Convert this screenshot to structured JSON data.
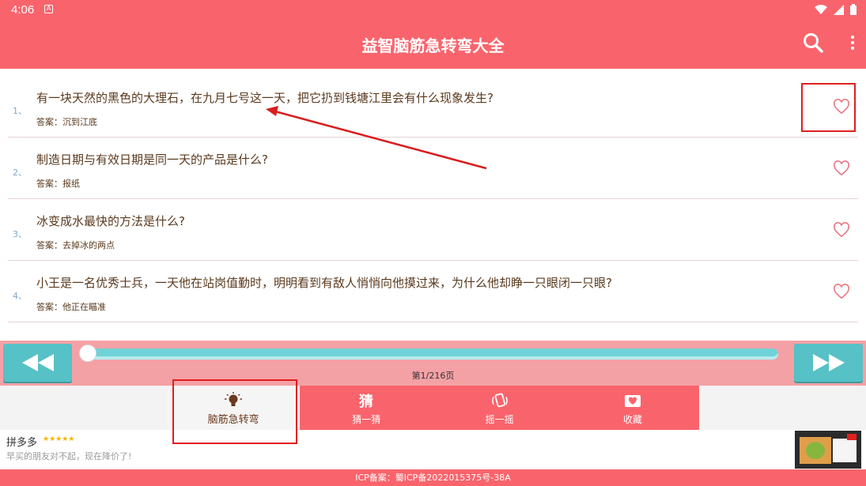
{
  "status": {
    "time": "4:06",
    "a_icon": "A"
  },
  "appbar": {
    "title": "益智脑筋急转弯大全",
    "search_icon": "search-icon",
    "menu_icon": "more-vert-icon"
  },
  "colors": {
    "primary": "#f9646c",
    "accent": "#56c1c6",
    "text": "#5a3a1e"
  },
  "items": [
    {
      "num": "1、",
      "question": "有一块天然的黑色的大理石，在九月七号这一天，把它扔到钱塘江里会有什么现象发生?",
      "answer": "答案：沉到江底"
    },
    {
      "num": "2、",
      "question": "制造日期与有效日期是同一天的产品是什么?",
      "answer": "答案：报纸"
    },
    {
      "num": "3、",
      "question": "冰变成水最快的方法是什么?",
      "answer": "答案：去掉冰的两点"
    },
    {
      "num": "4、",
      "question": "小王是一名优秀士兵，一天他在站岗值勤时，明明看到有敌人悄悄向他摸过来，为什么他却睁一只眼闭一只眼?",
      "answer": "答案：他正在瞄准"
    }
  ],
  "pager": {
    "page_text": "第1/216页",
    "progress": 0
  },
  "tabs": [
    {
      "label": "脑筋急转弯",
      "icon": "lightbulb-icon",
      "active": true
    },
    {
      "label": "猜一猜",
      "icon": "guess-icon",
      "active": false
    },
    {
      "label": "摇一摇",
      "icon": "shake-icon",
      "active": false
    },
    {
      "label": "收藏",
      "icon": "favorites-icon",
      "active": false
    }
  ],
  "ad": {
    "name": "拼多多",
    "stars": "★★★★★",
    "desc": "早买的朋友对不起，现在降价了!"
  },
  "icp": "ICP备案：蜀ICP备2022015375号-38A"
}
